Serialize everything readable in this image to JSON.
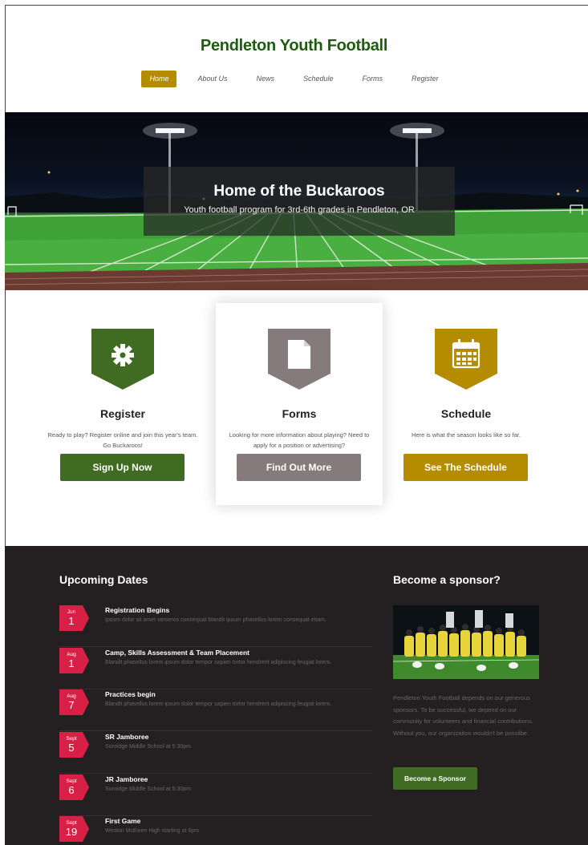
{
  "site": {
    "title": "Pendleton Youth Football"
  },
  "nav": {
    "items": [
      {
        "label": "Home",
        "active": true
      },
      {
        "label": "About Us"
      },
      {
        "label": "News"
      },
      {
        "label": "Schedule"
      },
      {
        "label": "Forms"
      },
      {
        "label": "Register"
      }
    ]
  },
  "hero": {
    "title": "Home of the Buckaroos",
    "subtitle": "Youth football program for 3rd-6th grades in Pendleton, OR"
  },
  "features": [
    {
      "icon": "gear-icon",
      "color": "#3f6b22",
      "title": "Register",
      "text": "Ready to play? Register online and join this year's team. Go Buckaroos!",
      "button": "Sign Up Now"
    },
    {
      "icon": "document-icon",
      "color": "#857a7c",
      "title": "Forms",
      "text": "Looking for more information about playing? Need to apply for a position or advertising?",
      "button": "Find Out More"
    },
    {
      "icon": "calendar-icon",
      "color": "#b58b00",
      "title": "Schedule",
      "text": "Here is what the season looks like so far.",
      "button": "See The Schedule"
    }
  ],
  "upcoming": {
    "title": "Upcoming Dates",
    "events": [
      {
        "month": "Jun",
        "day": "1",
        "title": "Registration Begins",
        "desc": "Ipsum dolor sit amet veroeros consequat blandit ipsum phasellus lorem consequat etiam."
      },
      {
        "month": "Aug",
        "day": "1",
        "title": "Camp, Skills Assessment & Team Placement",
        "desc": "Blandit phasellus lorem ipsum dolor tempor sapien tortor hendrerit adipiscing feugiat lorem."
      },
      {
        "month": "Aug",
        "day": "7",
        "title": "Practices begin",
        "desc": "Blandit phasellus lorem ipsum dolor tempor sapien tortor hendrerit adipiscing feugiat lorem."
      },
      {
        "month": "Sept",
        "day": "5",
        "title": "SR Jamboree",
        "desc": "Sunridge Middle School at 5:30pm"
      },
      {
        "month": "Sept",
        "day": "6",
        "title": "JR Jamboree",
        "desc": "Sunridge Middle School at 5:30pm"
      },
      {
        "month": "Sept",
        "day": "19",
        "title": "First Game",
        "desc": "Weston McEwen High starting at 6pm"
      }
    ]
  },
  "sponsor": {
    "title": "Become a sponsor?",
    "text": "Pendleton Youth Football depends on our generous sponsors. To be successful, we depend on our community for volunteers and financial contributions. Without you, our organizaiton wouldn't be possilbe.",
    "button": "Become a Sponsor"
  },
  "colors": {
    "brand_green": "#1f5c12",
    "accent_gold": "#b58b00",
    "date_red": "#d81f45",
    "dark_bg": "#242021"
  }
}
